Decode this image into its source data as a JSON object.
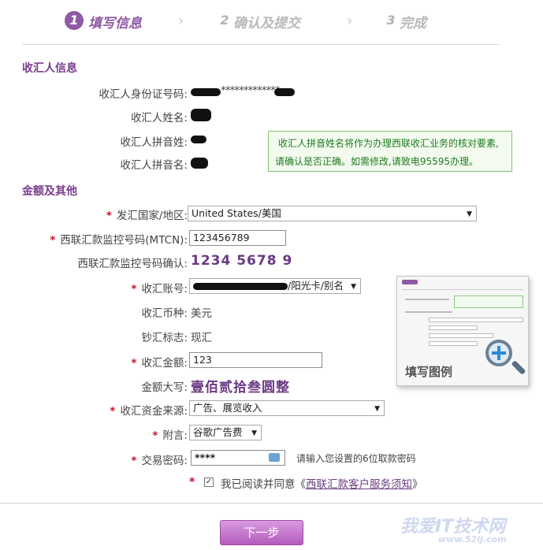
{
  "steps": [
    {
      "num": "1",
      "label": "填写信息"
    },
    {
      "num": "2",
      "label": "确认及提交"
    },
    {
      "num": "3",
      "label": "完成"
    }
  ],
  "receiver": {
    "section_title": "收汇人信息",
    "id_label": "收汇人身份证号码:",
    "id_value": "*************",
    "name_label": "收汇人姓名:",
    "pinyin_surname_label": "收汇人拼音姓:",
    "pinyin_given_label": "收汇人拼音名:",
    "notice_line1": "收汇人拼音姓名将作为办理西联收汇业务的核对要素,",
    "notice_line2": "请确认是否正确。如需修改,请致电95595办理。"
  },
  "amount": {
    "section_title": "金额及其他",
    "country_label": "发汇国家/地区:",
    "country_value": "United States/美国",
    "mtcn_label": "西联汇款监控号码(MTCN):",
    "mtcn_value": "123456789",
    "mtcn_confirm_label": "西联汇款监控号码确认:",
    "mtcn_confirm_value": "1234 5678 9",
    "account_label": "收汇账号:",
    "account_value": "/阳光卡/别名",
    "currency_label": "收汇币种:",
    "currency_value": "美元",
    "cash_label": "钞汇标志:",
    "cash_value": "现汇",
    "amount_label": "收汇金额:",
    "amount_value": "123",
    "caps_label": "金额大写:",
    "caps_value": "壹佰贰拾叁圆整",
    "source_label": "收汇资金来源:",
    "source_value": "广告、展览收入",
    "remark_label": "附言:",
    "remark_value": "谷歌广告费",
    "password_label": "交易密码:",
    "password_value": "****",
    "password_hint": "请输入您设置的6位取款密码",
    "agree_text": "我已阅读并同意《",
    "agree_link": "西联汇款客户服务须知",
    "agree_close": "》"
  },
  "example": {
    "label": "填写图例"
  },
  "next_button": "下一步",
  "watermark": {
    "text": "我爱IT技术网",
    "url": "www.52ij.com"
  },
  "colors": {
    "accent": "#8f5aa4",
    "required": "#c8102e",
    "notice_green": "#1f7a1f"
  }
}
